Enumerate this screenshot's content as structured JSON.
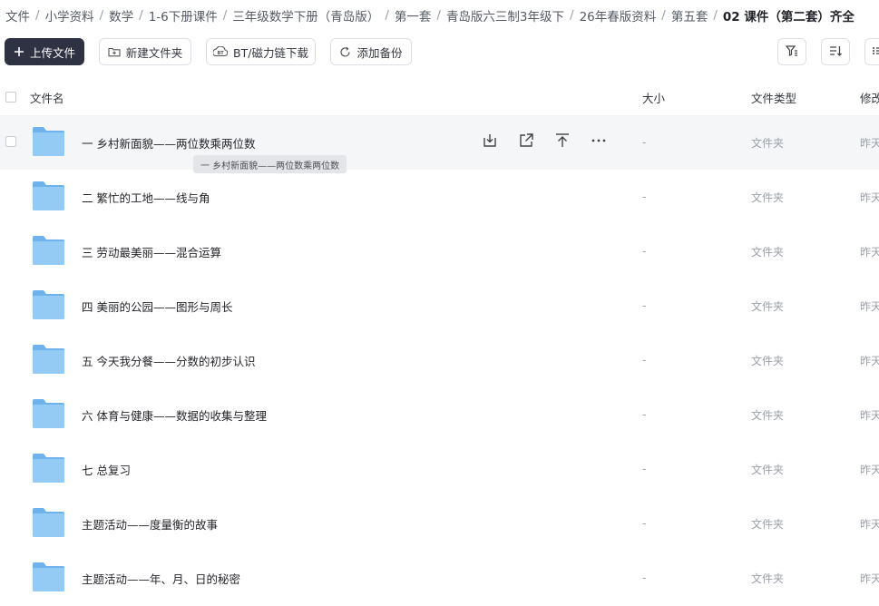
{
  "breadcrumb": {
    "items": [
      "文件",
      "小学资料",
      "数学",
      "1-6下册课件",
      "三年级数学下册（青岛版）",
      "第一套",
      "青岛版六三制3年级下",
      "26年春版资料",
      "第五套"
    ],
    "current": "02 课件（第二套）齐全",
    "separator": "/"
  },
  "toolbar": {
    "upload_label": "上传文件",
    "new_folder_label": "新建文件夹",
    "bt_label": "BT/磁力链下载",
    "backup_label": "添加备份"
  },
  "table": {
    "headers": {
      "name": "文件名",
      "size": "大小",
      "type": "文件类型",
      "modified": "修改"
    },
    "rows": [
      {
        "name": "一  乡村新面貌——两位数乘两位数",
        "size": "-",
        "type": "文件夹",
        "modified": "昨天"
      },
      {
        "name": "二  繁忙的工地——线与角",
        "size": "-",
        "type": "文件夹",
        "modified": "昨天"
      },
      {
        "name": "三  劳动最美丽——混合运算",
        "size": "-",
        "type": "文件夹",
        "modified": "昨天"
      },
      {
        "name": "四  美丽的公园——图形与周长",
        "size": "-",
        "type": "文件夹",
        "modified": "昨天"
      },
      {
        "name": "五  今天我分餐——分数的初步认识",
        "size": "-",
        "type": "文件夹",
        "modified": "昨天"
      },
      {
        "name": "六  体育与健康——数据的收集与整理",
        "size": "-",
        "type": "文件夹",
        "modified": "昨天"
      },
      {
        "name": "七  总复习",
        "size": "-",
        "type": "文件夹",
        "modified": "昨天"
      },
      {
        "name": "主题活动——度量衡的故事",
        "size": "-",
        "type": "文件夹",
        "modified": "昨天"
      },
      {
        "name": "主题活动——年、月、日的秘密",
        "size": "-",
        "type": "文件夹",
        "modified": "昨天"
      }
    ]
  },
  "tooltip": {
    "text": "一 乡村新面貌——两位数乘两位数"
  },
  "colors": {
    "primary_button": "#2f3242",
    "hover_row": "#f4f6f8",
    "folder": "#7fbef0"
  },
  "icons": {
    "row_actions": [
      "download-icon",
      "share-icon",
      "upload-to-top-icon",
      "more-icon"
    ],
    "toolbar_right": [
      "filter-icon",
      "sort-icon",
      "view-mode-icon"
    ]
  }
}
